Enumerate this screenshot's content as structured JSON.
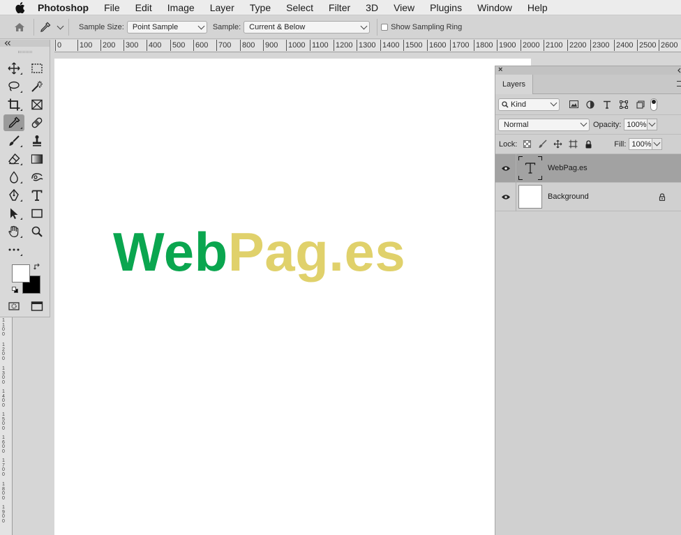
{
  "menubar": {
    "apple_icon": "apple-logo-icon",
    "app_name": "Photoshop",
    "items": [
      "File",
      "Edit",
      "Image",
      "Layer",
      "Type",
      "Select",
      "Filter",
      "3D",
      "View",
      "Plugins",
      "Window",
      "Help"
    ]
  },
  "options_bar": {
    "sample_size_label": "Sample Size:",
    "sample_size_value": "Point Sample",
    "sample_label": "Sample:",
    "sample_value": "Current & Below",
    "show_sampling_ring_label": "Show Sampling Ring",
    "show_sampling_ring_checked": false
  },
  "ruler": {
    "top_ticks": [
      "0",
      "100",
      "200",
      "300",
      "400",
      "500",
      "600",
      "700",
      "800",
      "900",
      "1000",
      "1100",
      "1200",
      "1300",
      "1400",
      "1500",
      "1600",
      "1700",
      "1800",
      "1900",
      "2000",
      "2100",
      "2200",
      "2300",
      "2400",
      "2500",
      "2600"
    ],
    "left_ticks": [
      "1100",
      "1200",
      "1300",
      "1400",
      "1500",
      "1600",
      "1700",
      "1800",
      "1900"
    ]
  },
  "toolbar": {
    "tools": [
      "move-tool",
      "rectangular-marquee-tool",
      "lasso-tool",
      "magic-wand-tool",
      "crop-tool",
      "frame-tool",
      "eyedropper-tool",
      "healing-brush-tool",
      "brush-tool",
      "clone-stamp-tool",
      "eraser-tool",
      "gradient-tool",
      "blur-tool",
      "dodge-tool",
      "pen-tool",
      "type-tool",
      "path-selection-tool",
      "rectangle-tool",
      "hand-tool",
      "zoom-tool",
      "edit-toolbar"
    ],
    "active_tool": "eyedropper-tool",
    "foreground_color": "#ffffff",
    "background_color": "#000000"
  },
  "document": {
    "logo_part1": "Web",
    "logo_part2": "Pag.es",
    "logo_color1": "#0aa64f",
    "logo_color2": "#e0d16b"
  },
  "layers_panel": {
    "tab_label": "Layers",
    "filter_kind": "Kind",
    "blend_mode": "Normal",
    "opacity_label": "Opacity:",
    "opacity_value": "100%",
    "lock_label": "Lock:",
    "fill_label": "Fill:",
    "fill_value": "100%",
    "layers": [
      {
        "name": "WebPag.es",
        "type": "text",
        "visible": true,
        "selected": true,
        "locked": false
      },
      {
        "name": "Background",
        "type": "pixel",
        "visible": true,
        "selected": false,
        "locked": true
      }
    ]
  }
}
